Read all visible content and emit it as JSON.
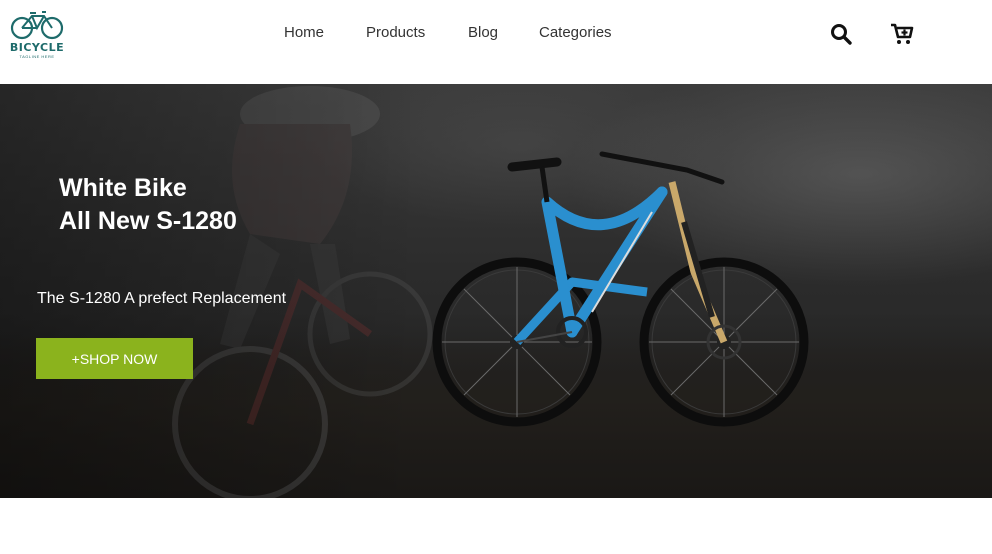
{
  "header": {
    "logo": {
      "brand": "BICYCLE",
      "tagline": "TAGLINE HERE",
      "icon": "bicycle-icon"
    },
    "nav": [
      {
        "label": "Home"
      },
      {
        "label": "Products"
      },
      {
        "label": "Blog"
      },
      {
        "label": "Categories"
      }
    ],
    "icons": {
      "search": "search-icon",
      "cart": "cart-plus-icon"
    }
  },
  "hero": {
    "title_line1": "White Bike",
    "title_line2": "All New S-1280",
    "subtitle": "The S-1280 A prefect Replacement",
    "cta_label": "+SHOP NOW"
  },
  "colors": {
    "accent": "#8bb31d",
    "logo": "#1e6b6b",
    "bike_frame": "#2a8fcf",
    "nav_text": "#333333"
  }
}
